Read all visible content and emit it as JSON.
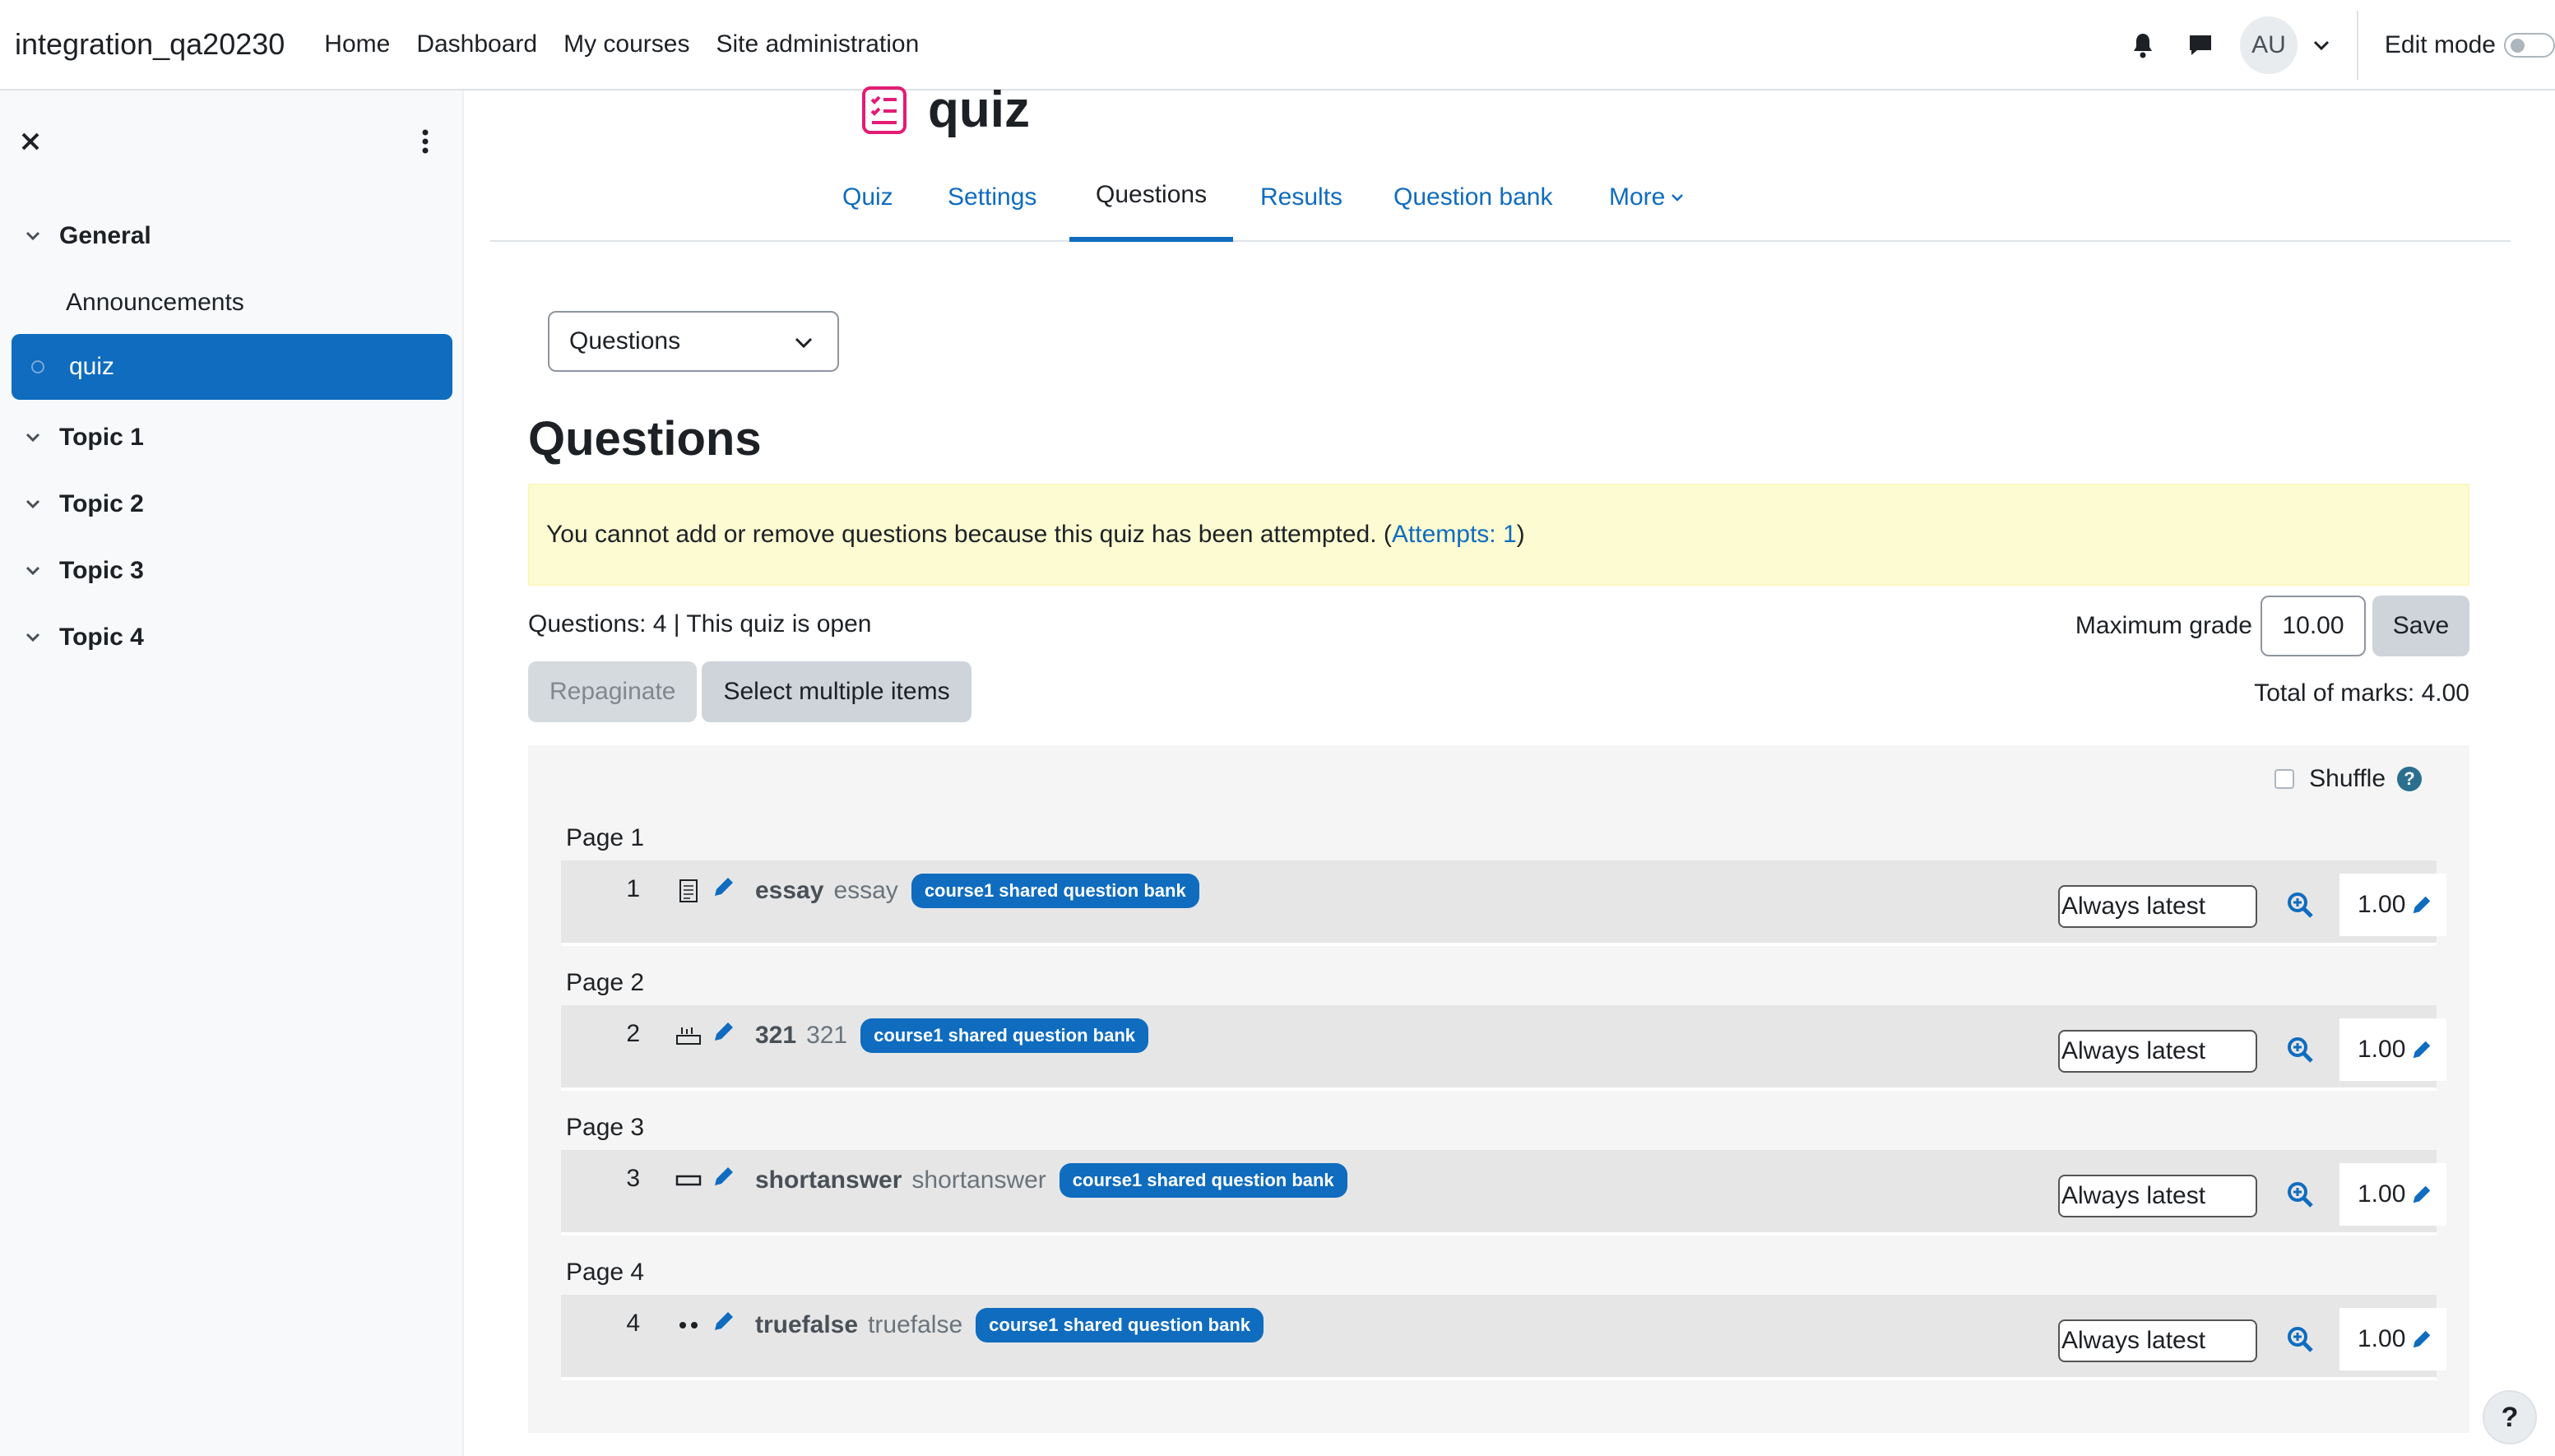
{
  "navbar": {
    "site_name": "integration_qa20230",
    "links": [
      "Home",
      "Dashboard",
      "My courses",
      "Site administration"
    ],
    "avatar_initials": "AU",
    "edit_mode_label": "Edit mode",
    "icons": [
      "bell-icon",
      "chat-icon",
      "chevron-down-icon"
    ]
  },
  "course_index": {
    "sections": [
      {
        "label": "General",
        "items": [
          "Announcements",
          "quiz"
        ]
      },
      {
        "label": "Topic 1"
      },
      {
        "label": "Topic 2"
      },
      {
        "label": "Topic 3"
      },
      {
        "label": "Topic 4"
      }
    ],
    "active_item": "quiz"
  },
  "activity": {
    "title": "quiz",
    "icon": "quiz-icon",
    "accent_color": "#e31c75"
  },
  "secondary_nav": {
    "tabs": [
      "Quiz",
      "Settings",
      "Questions",
      "Results",
      "Question bank",
      "More"
    ],
    "active": "Questions"
  },
  "page": {
    "select_value": "Questions",
    "heading": "Questions",
    "alert_text": "You cannot add or remove questions because this quiz has been attempted. (",
    "alert_link": "Attempts: 1",
    "alert_suffix": ")",
    "status_line": "Questions: 4 | This quiz is open",
    "max_grade_label": "Maximum grade",
    "max_grade_value": "10.00",
    "save_label": "Save",
    "repaginate_label": "Repaginate",
    "select_multiple_label": "Select multiple items",
    "total_marks": "Total of marks: 4.00",
    "shuffle_label": "Shuffle",
    "help_label": "?"
  },
  "slots": [
    {
      "page": "Page 1",
      "number": "1",
      "type_icon": "essay-icon",
      "name": "essay",
      "text": "essay",
      "badge": "course1 shared question bank",
      "version": "Always latest",
      "mark": "1.00"
    },
    {
      "page": "Page 2",
      "number": "2",
      "type_icon": "numerical-icon",
      "name": "321",
      "text": "321",
      "badge": "course1 shared question bank",
      "version": "Always latest",
      "mark": "1.00"
    },
    {
      "page": "Page 3",
      "number": "3",
      "type_icon": "shortanswer-icon",
      "name": "shortanswer",
      "text": "shortanswer",
      "badge": "course1 shared question bank",
      "version": "Always latest",
      "mark": "1.00"
    },
    {
      "page": "Page 4",
      "number": "4",
      "type_icon": "truefalse-icon",
      "name": "truefalse",
      "text": "truefalse",
      "badge": "course1 shared question bank",
      "version": "Always latest",
      "mark": "1.00"
    }
  ],
  "footer": {
    "help_button": "?"
  }
}
